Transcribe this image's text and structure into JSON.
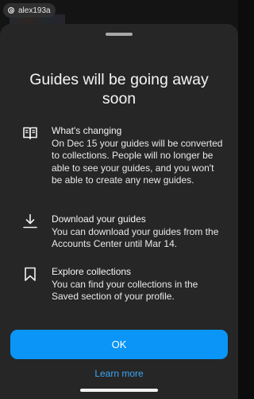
{
  "background": {
    "username": "alex193a"
  },
  "sheet": {
    "title": "Guides will be going away soon",
    "items": [
      {
        "icon": "book-icon",
        "heading": "What's changing",
        "body": "On Dec 15 your guides will be converted to collections. People will no longer be able to see your guides, and you won't be able to create any new guides."
      },
      {
        "icon": "download-icon",
        "heading": "Download your guides",
        "body": "You can download your guides from the Accounts Center until Mar 14."
      },
      {
        "icon": "bookmark-icon",
        "heading": "Explore collections",
        "body": "You can find your collections in the Saved section of your profile."
      }
    ],
    "ok_label": "OK",
    "learn_more_label": "Learn more"
  },
  "colors": {
    "sheet_background": "#262626",
    "primary_button": "#0a95f7",
    "link": "#3ea6f5"
  }
}
